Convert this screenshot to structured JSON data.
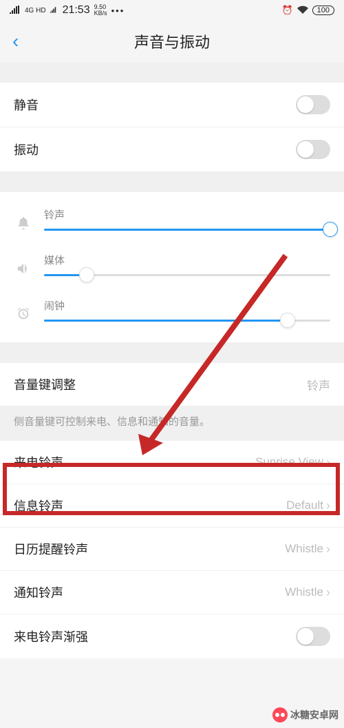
{
  "status": {
    "signal": "4G HD",
    "time": "21:53",
    "speed": "9.50\nKB/s",
    "dots": "•••",
    "battery": "100"
  },
  "header": {
    "back": "‹",
    "title": "声音与振动"
  },
  "toggles": {
    "mute": "静音",
    "vibrate": "振动"
  },
  "sliders": {
    "ringtone": {
      "label": "铃声",
      "value": 100
    },
    "media": {
      "label": "媒体",
      "value": 15
    },
    "alarm": {
      "label": "闹钟",
      "value": 85
    }
  },
  "volumeKey": {
    "label": "音量键调整",
    "value": "铃声",
    "help": "侧音量键可控制来电、信息和通知的音量。"
  },
  "ringtones": {
    "incoming": {
      "label": "来电铃声",
      "value": "Sunrise View"
    },
    "message": {
      "label": "信息铃声",
      "value": "Default"
    },
    "calendar": {
      "label": "日历提醒铃声",
      "value": "Whistle"
    },
    "notification": {
      "label": "通知铃声",
      "value": "Whistle"
    },
    "fadein": {
      "label": "来电铃声渐强"
    }
  },
  "watermark": "冰糖安卓网"
}
